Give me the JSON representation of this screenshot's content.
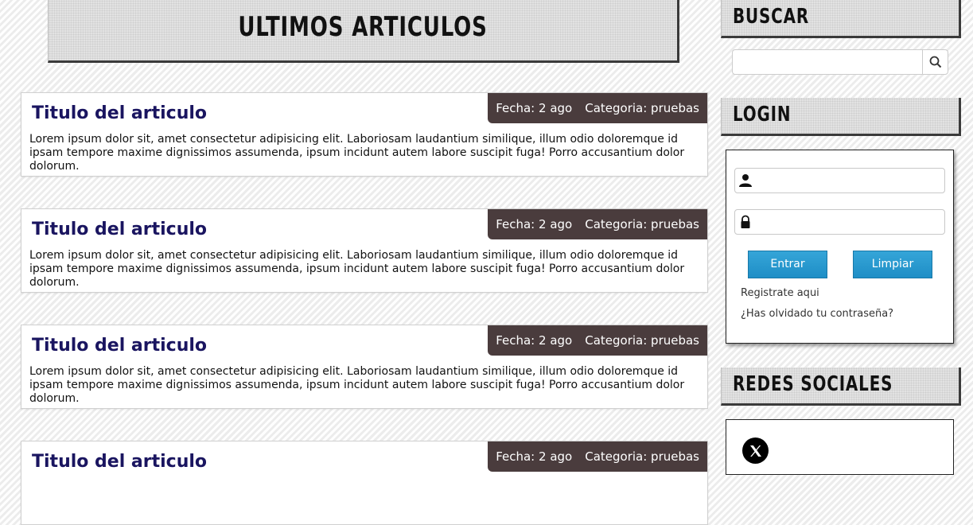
{
  "main_heading": "ULTIMOS ARTICULOS",
  "articles": [
    {
      "title": "Titulo del articulo",
      "date_label": "Fecha: 2 ago",
      "category_label": "Categoria: pruebas",
      "body": "Lorem ipsum dolor sit, amet consectetur adipisicing elit. Laboriosam laudantium similique, illum odio doloremque id ipsam tempore maxime dignissimos assumenda, ipsum incidunt autem labore suscipit fuga! Porro accusantium dolor dolorum."
    },
    {
      "title": "Titulo del articulo",
      "date_label": "Fecha: 2 ago",
      "category_label": "Categoria: pruebas",
      "body": "Lorem ipsum dolor sit, amet consectetur adipisicing elit. Laboriosam laudantium similique, illum odio doloremque id ipsam tempore maxime dignissimos assumenda, ipsum incidunt autem labore suscipit fuga! Porro accusantium dolor dolorum."
    },
    {
      "title": "Titulo del articulo",
      "date_label": "Fecha: 2 ago",
      "category_label": "Categoria: pruebas",
      "body": "Lorem ipsum dolor sit, amet consectetur adipisicing elit. Laboriosam laudantium similique, illum odio doloremque id ipsam tempore maxime dignissimos assumenda, ipsum incidunt autem labore suscipit fuga! Porro accusantium dolor dolorum."
    },
    {
      "title": "Titulo del articulo",
      "date_label": "Fecha: 2 ago",
      "category_label": "Categoria: pruebas",
      "body": ""
    }
  ],
  "sidebar": {
    "search": {
      "heading": "BUSCAR",
      "value": "",
      "placeholder": "",
      "icon": "search-icon"
    },
    "login": {
      "heading": "LOGIN",
      "username_value": "",
      "password_value": "",
      "user_icon": "user-icon",
      "lock_icon": "lock-icon",
      "submit_label": "Entrar",
      "clear_label": "Limpiar",
      "register_link": "Registrate aqui",
      "forgot_link": "¿Has olvidado tu contraseña?"
    },
    "social": {
      "heading": "REDES SOCIALES",
      "icons": [
        "x-icon"
      ]
    }
  },
  "colors": {
    "article_title": "#1a1560",
    "meta_tag_bg": "#4a3c3d",
    "button_blue": "#2a9ad0"
  }
}
